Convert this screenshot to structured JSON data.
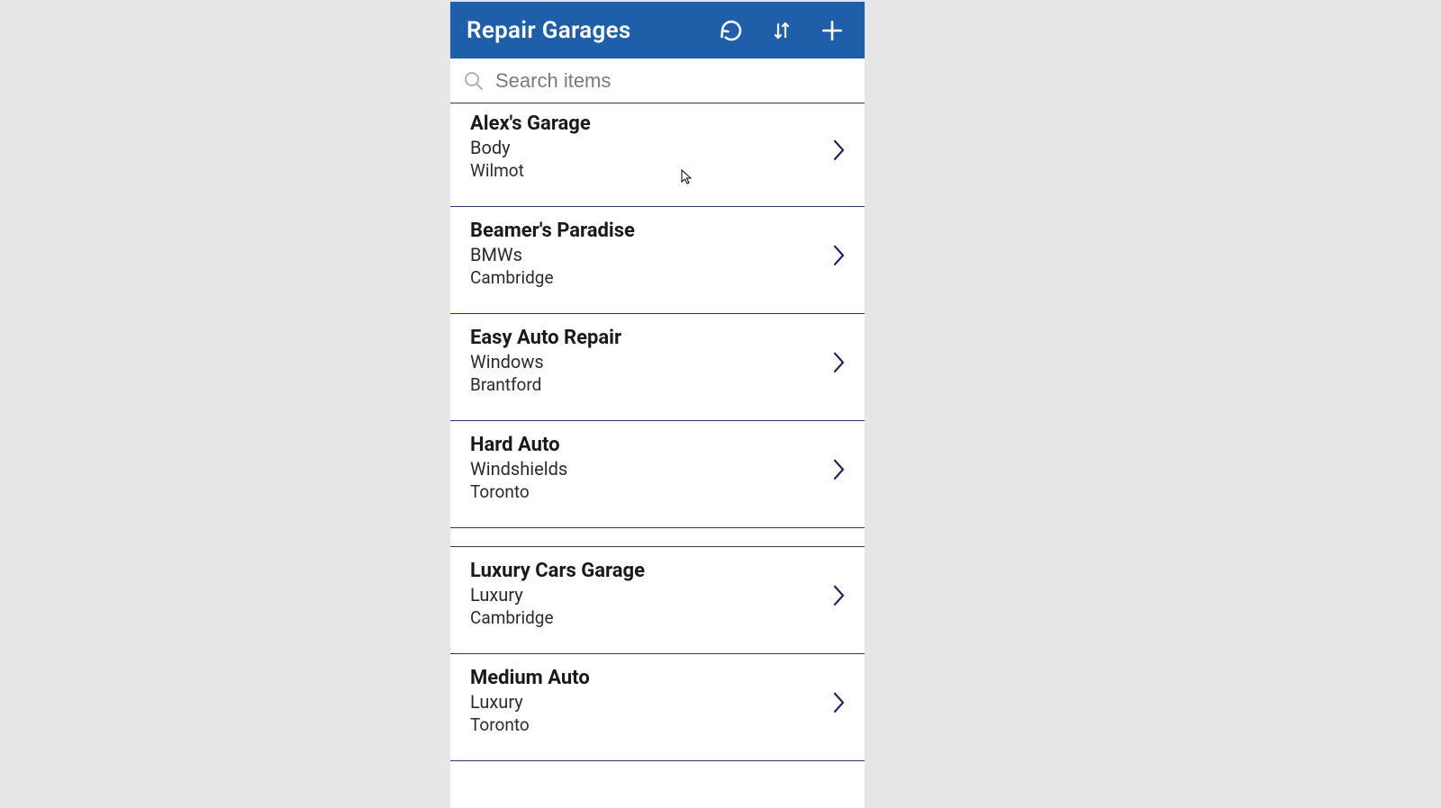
{
  "header": {
    "title": "Repair Garages"
  },
  "search": {
    "placeholder": "Search items",
    "value": ""
  },
  "garages": [
    {
      "name": "Alex's Garage",
      "specialty": "Body",
      "city": "Wilmot",
      "group_gap": false
    },
    {
      "name": "Beamer's Paradise",
      "specialty": "BMWs",
      "city": "Cambridge",
      "group_gap": false
    },
    {
      "name": "Easy Auto Repair",
      "specialty": "Windows",
      "city": "Brantford",
      "group_gap": false
    },
    {
      "name": "Hard Auto",
      "specialty": "Windshields",
      "city": "Toronto",
      "group_gap": false
    },
    {
      "name": "Luxury Cars Garage",
      "specialty": "Luxury",
      "city": "Cambridge",
      "group_gap": true
    },
    {
      "name": "Medium Auto",
      "specialty": "Luxury",
      "city": "Toronto",
      "group_gap": false
    }
  ],
  "colors": {
    "header_bg": "#1f5fa9",
    "divider": "#2a3b62",
    "bg": "#e7e7e7"
  }
}
